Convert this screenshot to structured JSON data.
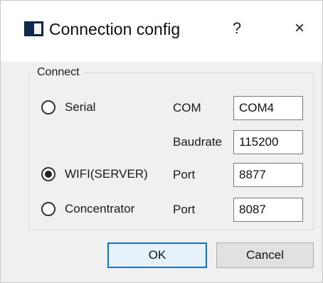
{
  "window": {
    "title": "Connection config",
    "help_label": "?",
    "close_label": "×"
  },
  "group": {
    "label": "Connect"
  },
  "options": {
    "serial": {
      "label": "Serial",
      "checked": false
    },
    "wifi": {
      "label": "WIFI(SERVER)",
      "checked": true
    },
    "concentrator": {
      "label": "Concentrator",
      "checked": false
    }
  },
  "fields": {
    "com": {
      "label": "COM",
      "value": "COM4"
    },
    "baudrate": {
      "label": "Baudrate",
      "value": "115200"
    },
    "wifi_port": {
      "label": "Port",
      "value": "8877"
    },
    "concentrator_port": {
      "label": "Port",
      "value": "8087"
    }
  },
  "buttons": {
    "ok_label": "OK",
    "cancel_label": "Cancel"
  },
  "colors": {
    "accent": "#0078d7",
    "dialog_bg": "#f0f0f0"
  }
}
